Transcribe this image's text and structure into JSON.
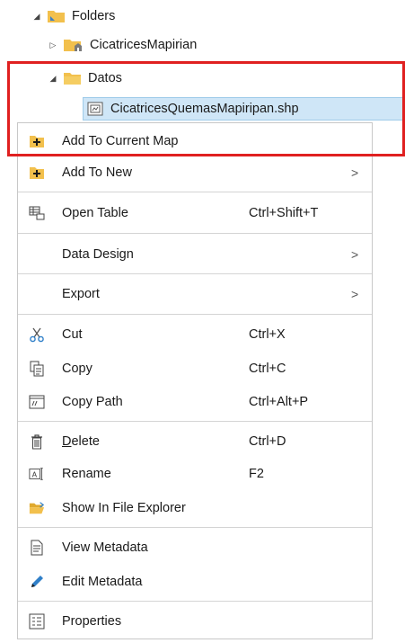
{
  "tree": {
    "folders_label": "Folders",
    "cicatrices_label": "CicatricesMapirian",
    "datos_label": "Datos",
    "selected_file_label": "CicatricesQuemasMapiripan.shp"
  },
  "menu": {
    "add_current": "Add To Current Map",
    "add_new": "Add To New",
    "open_table": "Open Table",
    "open_table_shortcut": "Ctrl+Shift+T",
    "data_design": "Data Design",
    "export": "Export",
    "cut": "Cut",
    "cut_shortcut": "Ctrl+X",
    "copy": "Copy",
    "copy_shortcut": "Ctrl+C",
    "copy_path": "Copy Path",
    "copy_path_shortcut": "Ctrl+Alt+P",
    "delete_prefix": "D",
    "delete_rest": "elete",
    "delete_shortcut": "Ctrl+D",
    "rename": "Rename",
    "rename_shortcut": "F2",
    "show_explorer": "Show In File Explorer",
    "view_metadata": "View Metadata",
    "edit_metadata": "Edit Metadata",
    "properties": "Properties",
    "submenu_arrow": ">"
  },
  "colors": {
    "highlight_border": "#e02020",
    "selection": "#cfe6f7",
    "folder": "#f2c04d"
  }
}
